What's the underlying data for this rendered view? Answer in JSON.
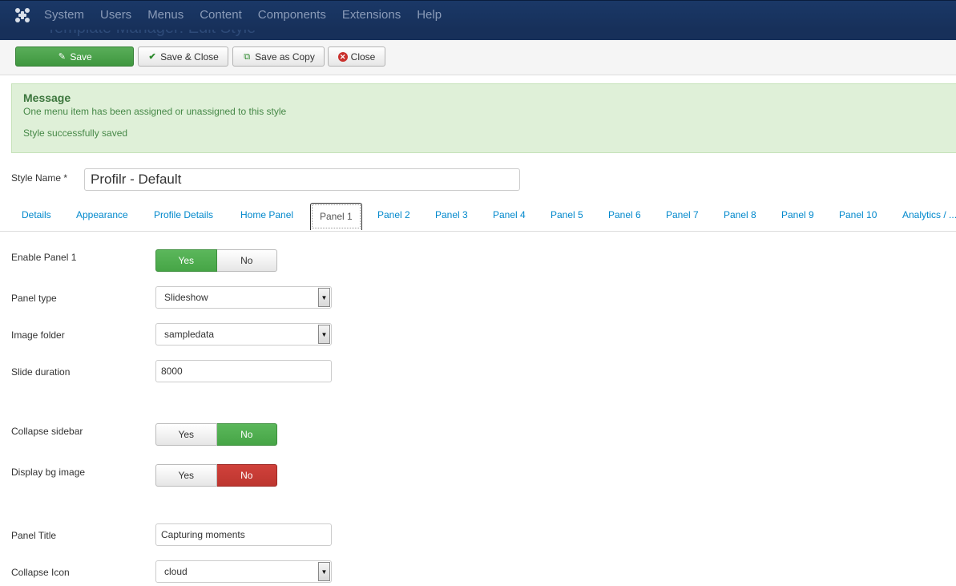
{
  "navbar": {
    "menu": [
      "System",
      "Users",
      "Menus",
      "Content",
      "Components",
      "Extensions",
      "Help"
    ],
    "page_title": "Template Manager: Edit Style"
  },
  "toolbar": {
    "save": "Save",
    "save_close": "Save & Close",
    "save_copy": "Save as Copy",
    "close": "Close"
  },
  "message": {
    "heading": "Message",
    "line1": "One menu item has been assigned or unassigned to this style",
    "line2": "Style successfully saved"
  },
  "style_name": {
    "label": "Style Name *",
    "value": "Profilr - Default"
  },
  "tabs": [
    "Details",
    "Appearance",
    "Profile Details",
    "Home Panel",
    "Panel 1",
    "Panel 2",
    "Panel 3",
    "Panel 4",
    "Panel 5",
    "Panel 6",
    "Panel 7",
    "Panel 8",
    "Panel 9",
    "Panel 10",
    "Analytics / ..."
  ],
  "active_tab": "Panel 1",
  "form": {
    "enable_panel": {
      "label": "Enable Panel 1",
      "yes": "Yes",
      "no": "No",
      "selected": "Yes"
    },
    "panel_type": {
      "label": "Panel type",
      "value": "Slideshow"
    },
    "image_folder": {
      "label": "Image folder",
      "value": "sampledata"
    },
    "slide_duration": {
      "label": "Slide duration",
      "value": "8000"
    },
    "collapse_sidebar": {
      "label": "Collapse sidebar",
      "yes": "Yes",
      "no": "No",
      "selected": "No"
    },
    "display_bg": {
      "label": "Display bg image",
      "yes": "Yes",
      "no": "No",
      "selected": "No"
    },
    "panel_title": {
      "label": "Panel Title",
      "value": "Capturing moments"
    },
    "collapse_icon": {
      "label": "Collapse Icon",
      "value": "cloud"
    }
  },
  "colors": {
    "navbar": "#1a3867",
    "success": "#46a546",
    "danger": "#bd362f",
    "link": "#0088cc"
  }
}
